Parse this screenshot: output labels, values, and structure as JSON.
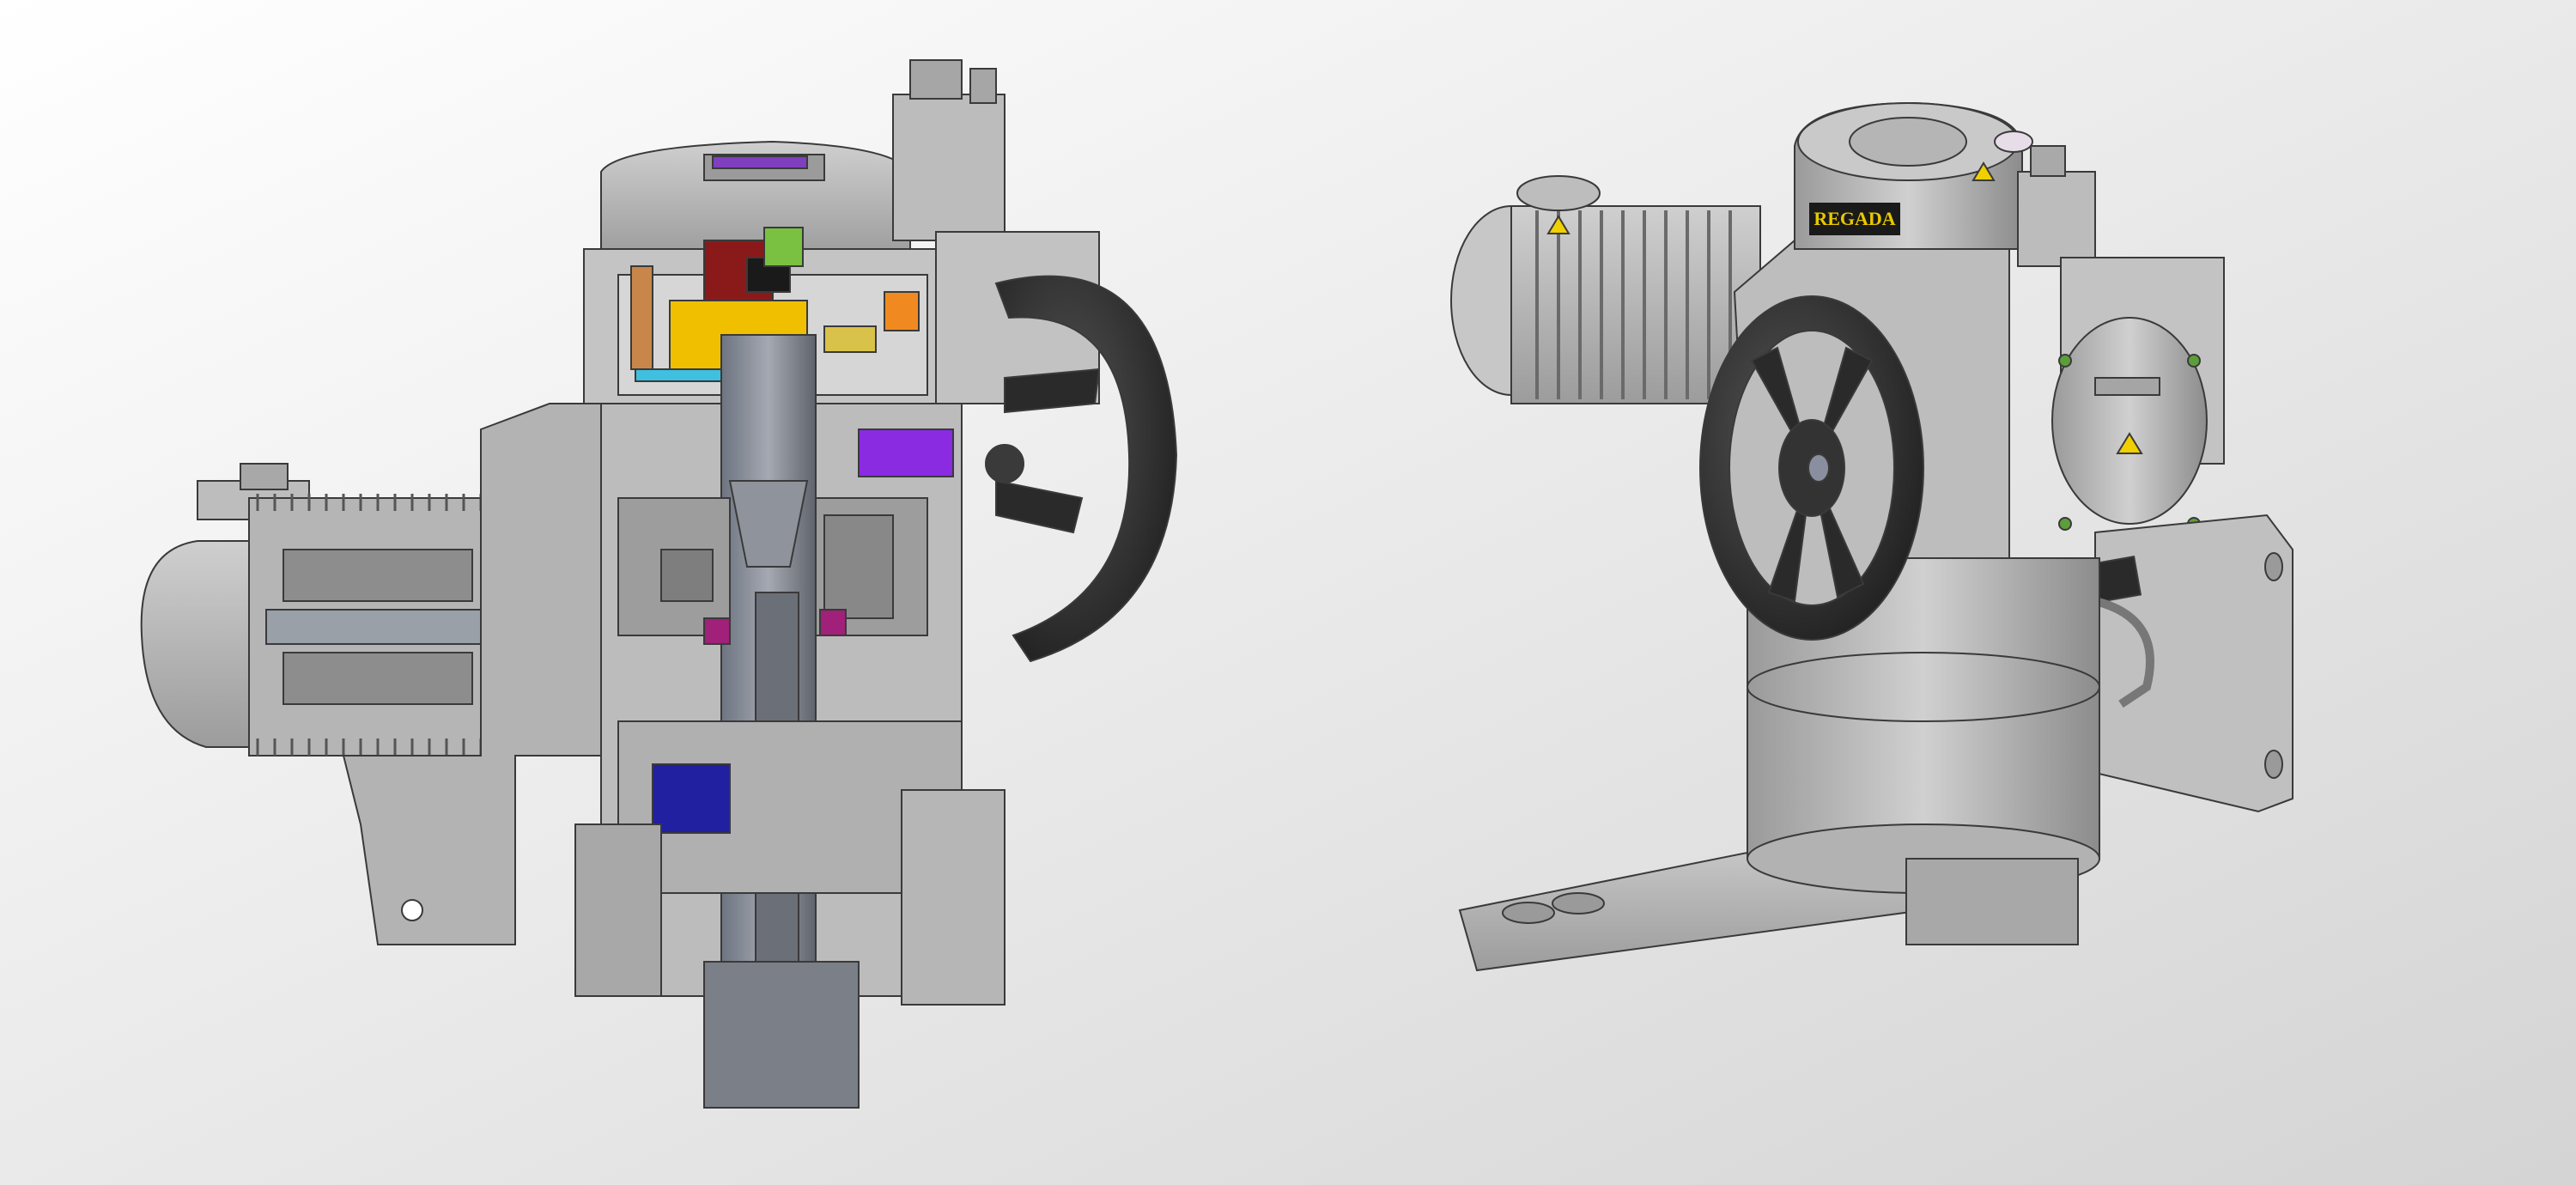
{
  "scene": {
    "background_colors": [
      "#ffffff",
      "#d4d4d4"
    ],
    "metal_color": "#b8b8b8",
    "handwheel_color": "#2e2e2e"
  },
  "cutaway_model": {
    "handwheel": {
      "icon": "handwheel-icon"
    },
    "components": [
      {
        "name": "electronics-board",
        "color": "#f0c000"
      },
      {
        "name": "relay-block",
        "color": "#8a1a1a"
      },
      {
        "name": "terminal-green",
        "color": "#7ac142"
      },
      {
        "name": "sensor-orange",
        "color": "#f08a20"
      },
      {
        "name": "cam-purple",
        "color": "#8a2be2"
      },
      {
        "name": "seal-magenta",
        "color": "#a0207a"
      },
      {
        "name": "coupling-blue",
        "color": "#2020a0"
      },
      {
        "name": "bus-bar-cyan",
        "color": "#40c0e0"
      }
    ]
  },
  "assembled_model": {
    "brand_label": "REGADA",
    "brand_label_colors": {
      "text": "#e8c800",
      "background": "#1a1a1a"
    },
    "warning_icon": "warning-triangle-icon"
  }
}
